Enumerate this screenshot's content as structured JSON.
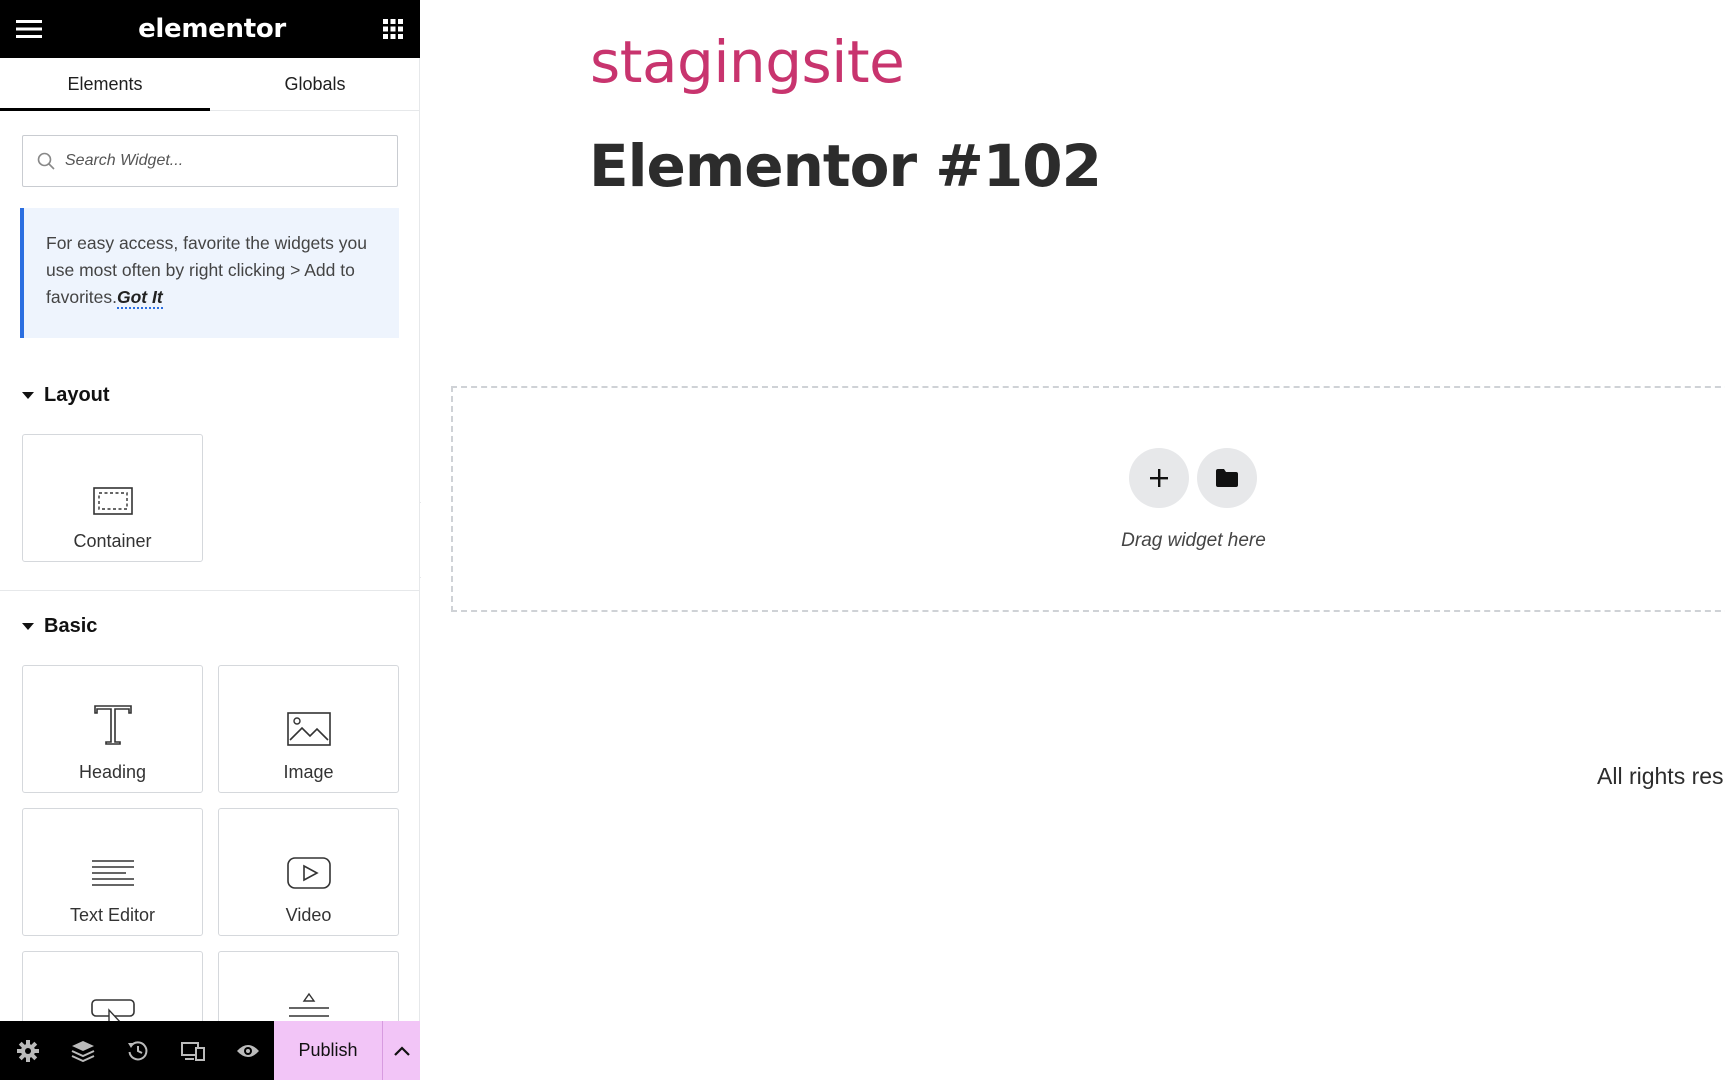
{
  "app": {
    "logo": "elementor"
  },
  "tabs": [
    {
      "label": "Elements"
    },
    {
      "label": "Globals"
    }
  ],
  "search": {
    "placeholder": "Search Widget..."
  },
  "notice": {
    "text": "For easy access, favorite the widgets you use most often by right clicking > Add to favorites.",
    "action": "Got It",
    "accent": "#2b6ee0"
  },
  "sections": {
    "layout": {
      "title": "Layout",
      "widgets": [
        {
          "label": "Container",
          "icon": "container-icon"
        }
      ]
    },
    "basic": {
      "title": "Basic",
      "widgets": [
        {
          "label": "Heading",
          "icon": "heading-icon"
        },
        {
          "label": "Image",
          "icon": "image-icon"
        },
        {
          "label": "Text Editor",
          "icon": "text-editor-icon"
        },
        {
          "label": "Video",
          "icon": "video-icon"
        },
        {
          "label": "",
          "icon": "button-icon"
        },
        {
          "label": "",
          "icon": "divider-icon"
        }
      ]
    }
  },
  "bottombar": {
    "icons": [
      "settings-icon",
      "layers-icon",
      "history-icon",
      "responsive-icon",
      "preview-icon"
    ],
    "publish_label": "Publish",
    "publish_color": "#f2c5f7"
  },
  "canvas": {
    "site_title": "stagingsite",
    "site_title_color": "#c8346e",
    "page_title": "Elementor #102",
    "dropzone_text": "Drag widget here",
    "footer_text": "All rights res"
  }
}
